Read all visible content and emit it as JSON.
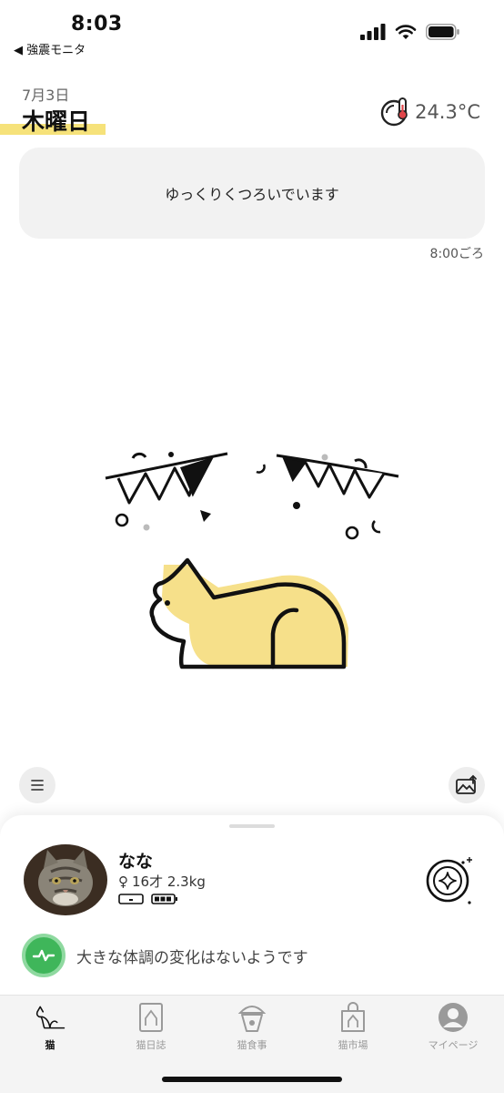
{
  "status_bar": {
    "time": "8:03",
    "back_app": "◀ 強震モニタ"
  },
  "header": {
    "date": "7月3日",
    "weekday": "木曜日",
    "temperature": "24.3°C",
    "accent_color": "#f6e27a"
  },
  "message": {
    "text": "ゆっくりくつろいでいます",
    "time": "8:00ごろ"
  },
  "illustration": {
    "icon": "resting-cat-illustration",
    "cat_color": "#f6e08a"
  },
  "buttons": {
    "menu_icon": "menu-lines-icon",
    "photo_icon": "photo-share-icon"
  },
  "cat_profile": {
    "name": "なな",
    "gender_symbol": "♀",
    "info": "16才 2.3kg",
    "devices": [
      "scale-device-icon",
      "battery-full-icon"
    ]
  },
  "health": {
    "text": "大きな体調の変化はないようです",
    "status_color": "#3fb65a"
  },
  "tabs": [
    {
      "label": "猫",
      "icon": "cat-icon",
      "active": true
    },
    {
      "label": "猫日誌",
      "icon": "diary-icon",
      "active": false
    },
    {
      "label": "猫食事",
      "icon": "food-bowl-icon",
      "active": false
    },
    {
      "label": "猫市場",
      "icon": "shopping-bag-icon",
      "active": false
    },
    {
      "label": "マイページ",
      "icon": "profile-icon",
      "active": false
    }
  ]
}
